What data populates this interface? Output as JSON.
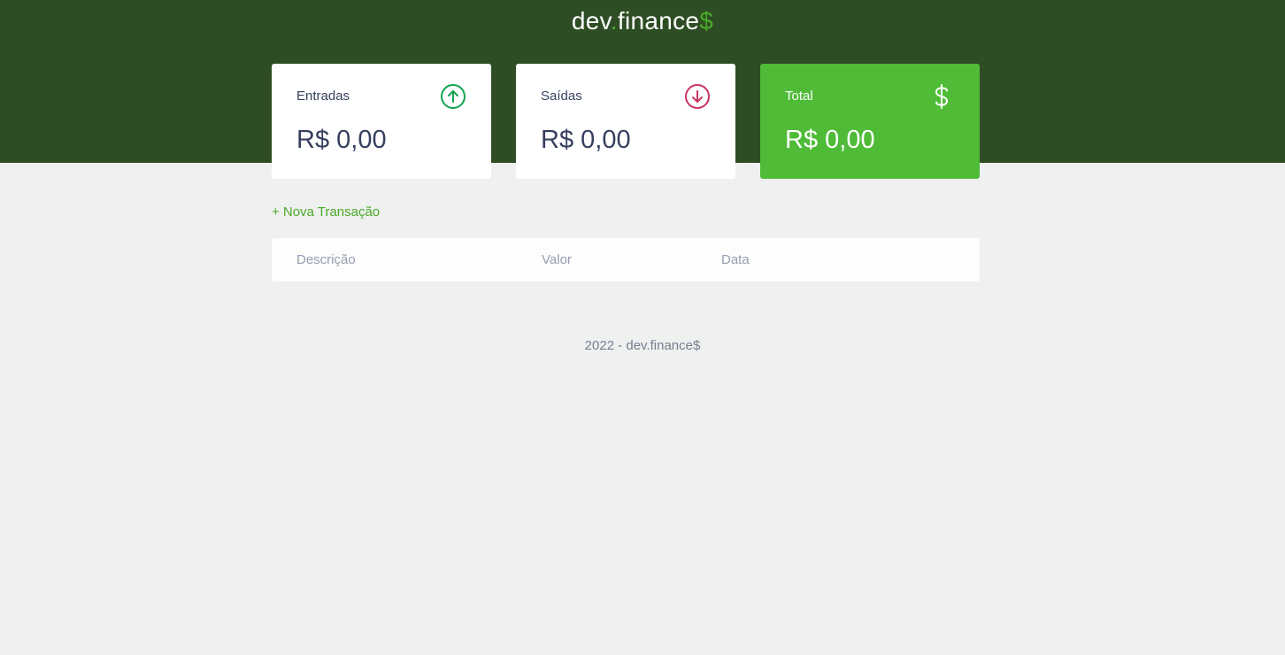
{
  "header": {
    "logo_prefix": "dev",
    "logo_dot": ".",
    "logo_main": "finance",
    "logo_suffix": "$"
  },
  "cards": {
    "income": {
      "label": "Entradas",
      "amount": "R$ 0,00",
      "icon": "arrow-up-circle-icon"
    },
    "expense": {
      "label": "Saídas",
      "amount": "R$ 0,00",
      "icon": "arrow-down-circle-icon"
    },
    "total": {
      "label": "Total",
      "amount": "R$ 0,00",
      "icon": "dollar-icon"
    }
  },
  "actions": {
    "new_transaction": "+ Nova Transação"
  },
  "table": {
    "columns": [
      "Descrição",
      "Valor",
      "Data"
    ]
  },
  "footer": {
    "text": "2022 - dev.finance$"
  },
  "colors": {
    "header_bg": "#2e4d24",
    "accent": "#49aa26",
    "total_card": "#4fbb37",
    "income_icon": "#12a454",
    "expense_icon": "#c8345e"
  }
}
